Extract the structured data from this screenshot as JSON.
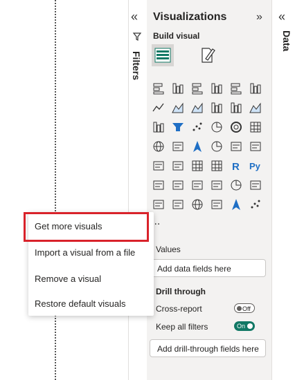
{
  "filters": {
    "collapse_glyph": "«",
    "label": "Filters"
  },
  "visualizations": {
    "title": "Visualizations",
    "expand_glyph": "»",
    "build_visual_label": "Build visual",
    "gallery_icons": [
      "stacked-bar-chart-icon",
      "stacked-column-chart-icon",
      "clustered-bar-chart-icon",
      "clustered-column-chart-icon",
      "100-stacked-bar-chart-icon",
      "100-stacked-column-chart-icon",
      "line-chart-icon",
      "area-chart-icon",
      "stacked-area-chart-icon",
      "line-and-stacked-column-chart-icon",
      "line-and-clustered-column-chart-icon",
      "ribbon-chart-icon",
      "waterfall-chart-icon",
      "funnel-chart-icon",
      "scatter-chart-icon",
      "pie-chart-icon",
      "donut-chart-icon",
      "treemap-icon",
      "map-icon",
      "filled-map-icon",
      "azure-map-icon",
      "gauge-icon",
      "card-icon",
      "multi-row-card-icon",
      "kpi-icon",
      "slicer-icon",
      "table-icon",
      "matrix-icon",
      "r-script-visual-icon",
      "python-visual-icon",
      "key-influencers-icon",
      "decomposition-tree-icon",
      "qna-icon",
      "smart-narrative-icon",
      "metrics-icon",
      "paginated-report-icon",
      "power-apps-icon",
      "power-automate-icon",
      "arcgis-map-icon",
      "diamond-visual-icon",
      "chevron-visual-icon",
      "dot-plot-icon"
    ],
    "more_glyph": "...",
    "values_section": "Values",
    "values_placeholder": "Add data fields here",
    "drill_through_title": "Drill through",
    "cross_report_label": "Cross-report",
    "cross_report_toggle": "Off",
    "keep_filters_label": "Keep all filters",
    "keep_filters_toggle": "On",
    "drill_placeholder": "Add drill-through fields here"
  },
  "data_pane": {
    "collapse_glyph": "«",
    "label": "Data"
  },
  "context_menu": {
    "items": [
      "Get more visuals",
      "Import a visual from a file",
      "Remove a visual",
      "Restore default visuals"
    ]
  },
  "colors": {
    "accent": "#117865",
    "highlight": "#d9222a",
    "pane_bg": "#f3f2f1",
    "blue_icon": "#1f6fc5"
  }
}
